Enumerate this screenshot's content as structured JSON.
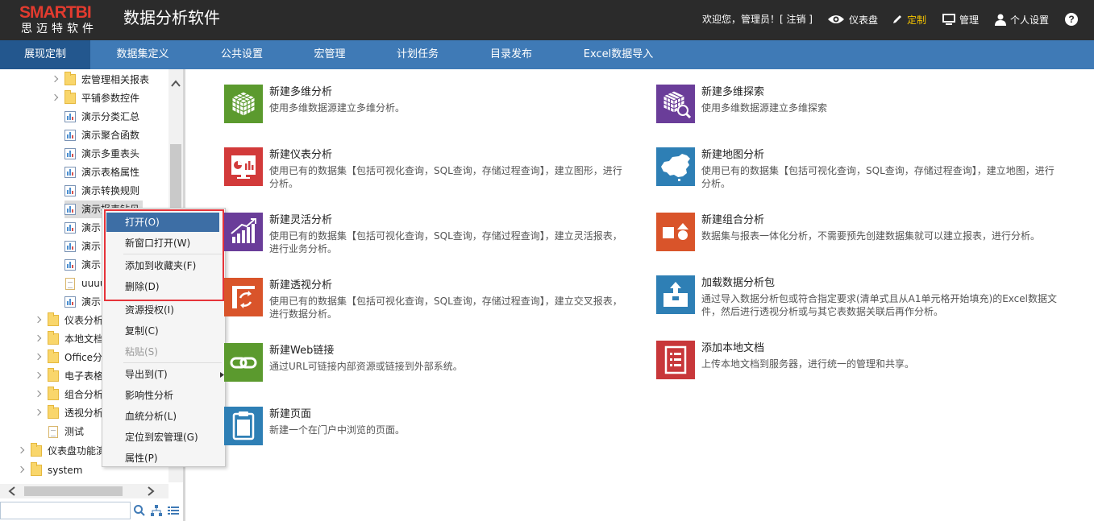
{
  "app": {
    "logo": "SMARTBI",
    "logo_sub": "思迈特软件",
    "title": "数据分析软件"
  },
  "header": {
    "welcome": "欢迎您，管理员！[ 注销 ]",
    "dashboard": "仪表盘",
    "customize": "定制",
    "manage": "管理",
    "personal": "个人设置",
    "help": "?"
  },
  "colors": {
    "header_bg": "#2b2b2b",
    "nav_bg": "#3f7ab6",
    "nav_active": "#23578e",
    "accent": "#f5c400",
    "highlight_border": "#e6333a"
  },
  "nav": [
    "展现定制",
    "数据集定义",
    "公共设置",
    "宏管理",
    "计划任务",
    "目录发布",
    "Excel数据导入"
  ],
  "tree": [
    {
      "label": "宏管理相关报表",
      "type": "folder",
      "expandable": true
    },
    {
      "label": "平铺参数控件",
      "type": "folder",
      "expandable": true
    },
    {
      "label": "演示分类汇总",
      "type": "report"
    },
    {
      "label": "演示聚合函数",
      "type": "report"
    },
    {
      "label": "演示多重表头",
      "type": "report"
    },
    {
      "label": "演示表格属性",
      "type": "report"
    },
    {
      "label": "演示转换规则",
      "type": "report"
    },
    {
      "label": "演示报表钻见",
      "type": "report"
    },
    {
      "label": "演示",
      "type": "report"
    },
    {
      "label": "演示",
      "type": "report"
    },
    {
      "label": "演示",
      "type": "report"
    },
    {
      "label": "uuuu",
      "type": "doc"
    },
    {
      "label": "演示",
      "type": "report"
    },
    {
      "label": "仪表分析",
      "type": "folder",
      "expandable": true
    },
    {
      "label": "本地文档",
      "type": "folder",
      "expandable": true
    },
    {
      "label": "Office分",
      "type": "folder",
      "expandable": true
    },
    {
      "label": "电子表格",
      "type": "folder",
      "expandable": true
    },
    {
      "label": "组合分析",
      "type": "folder",
      "expandable": true
    },
    {
      "label": "透视分析",
      "type": "folder",
      "expandable": true
    },
    {
      "label": "测试",
      "type": "doc"
    },
    {
      "label": "仪表盘功能演",
      "type": "folder",
      "expandable": true
    },
    {
      "label": "system",
      "type": "folder",
      "expandable": true
    }
  ],
  "context_menu": [
    {
      "label": "打开(O)",
      "highlighted": true
    },
    {
      "label": "新窗口打开(W)"
    },
    {
      "label": "添加到收藏夹(F)"
    },
    {
      "label": "删除(D)"
    },
    {
      "label": "资源授权(I)"
    },
    {
      "label": "复制(C)"
    },
    {
      "label": "粘贴(S)",
      "disabled": true
    },
    {
      "label": "导出到(T)",
      "submenu": true
    },
    {
      "label": "影响性分析"
    },
    {
      "label": "血统分析(L)"
    },
    {
      "label": "定位到宏管理(G)"
    },
    {
      "label": "属性(P)"
    }
  ],
  "cards": [
    {
      "title": "新建多维分析",
      "desc": "使用多维数据源建立多维分析。",
      "icon": "cube-icon",
      "color": "#5b9a2e"
    },
    {
      "title": "新建多维探索",
      "desc": "使用多维数据源建立多维探索",
      "icon": "cube-search-icon",
      "color": "#6a3d99"
    },
    {
      "title": "新建仪表分析",
      "desc": "使用已有的数据集【包括可视化查询，SQL查询，存储过程查询】，建立图形，进行分析。",
      "icon": "dashboard-chart-icon",
      "color": "#d23a3a"
    },
    {
      "title": "新建地图分析",
      "desc": "使用已有的数据集【包括可视化查询，SQL查询，存储过程查询】，建立地图，进行分析。",
      "icon": "china-map-icon",
      "color": "#2e7fb5"
    },
    {
      "title": "新建灵活分析",
      "desc": "使用已有的数据集【包括可视化查询，SQL查询，存储过程查询】，建立灵活报表，进行业务分析。",
      "icon": "bar-trend-icon",
      "color": "#6a3d99"
    },
    {
      "title": "新建组合分析",
      "desc": "数据集与报表一体化分析，不需要预先创建数据集就可以建立报表，进行分析。",
      "icon": "shapes-icon",
      "color": "#d9542a"
    },
    {
      "title": "新建透视分析",
      "desc": "使用已有的数据集【包括可视化查询，SQL查询，存储过程查询】，建立交叉报表，进行数据分析。",
      "icon": "pivot-icon",
      "color": "#d9542a"
    },
    {
      "title": "加载数据分析包",
      "desc": "通过导入数据分析包或符合指定要求(清单式且从A1单元格开始填充)的Excel数据文件，然后进行透视分析或与其它表数据关联后再作分析。",
      "icon": "package-icon",
      "color": "#2e7fb5"
    },
    {
      "title": "新建Web链接",
      "desc": "通过URL可链接内部资源或链接到外部系统。",
      "icon": "link-icon",
      "color": "#5b9a2e"
    },
    {
      "title": "添加本地文档",
      "desc": "上传本地文档到服务器，进行统一的管理和共享。",
      "icon": "document-icon",
      "color": "#c8373a"
    },
    {
      "title": "新建页面",
      "desc": "新建一个在门户中浏览的页面。",
      "icon": "page-icon",
      "color": "#2e7fb5"
    }
  ]
}
